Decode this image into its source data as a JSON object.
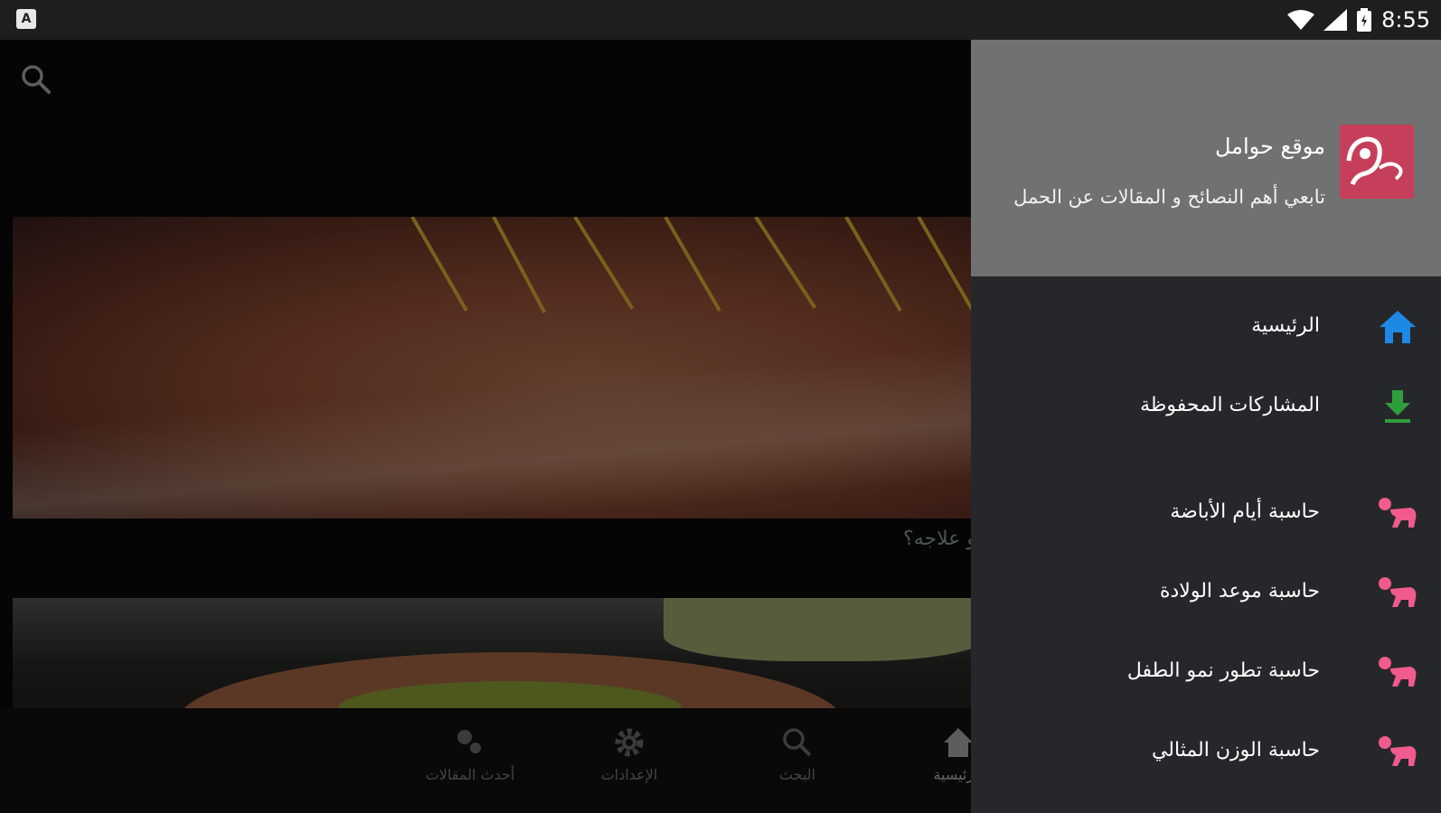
{
  "status_bar": {
    "left_icon_letter": "A",
    "time": "8:55",
    "icons": [
      "wifi-icon",
      "signal-icon",
      "battery-icon"
    ]
  },
  "main": {
    "search_icon": "search-icon",
    "card_caption": "و علاجه؟"
  },
  "bottom_nav": [
    {
      "label": "أحدث المقالات",
      "icon": "articles-icon"
    },
    {
      "label": "الإعدادات",
      "icon": "gear-icon"
    },
    {
      "label": "البحث",
      "icon": "search-icon"
    },
    {
      "label": "الرئيسية",
      "icon": "home-icon"
    }
  ],
  "drawer": {
    "app_name": "موقع حوامل",
    "tagline": "تابعي أهم النصائح و المقالات عن الحمل",
    "items": [
      {
        "label": "الرئيسية",
        "icon": "home-icon",
        "color": "#1e88e5"
      },
      {
        "label": "المشاركات المحفوظة",
        "icon": "download-icon",
        "color": "#2e9e3a"
      },
      {
        "label": "حاسبة أيام الأباضة",
        "icon": "baby-crawl-icon",
        "color": "#f05a8c"
      },
      {
        "label": "حاسبة موعد الولادة",
        "icon": "baby-crawl-icon",
        "color": "#f05a8c"
      },
      {
        "label": "حاسبة تطور نمو الطفل",
        "icon": "baby-crawl-icon",
        "color": "#f05a8c"
      },
      {
        "label": "حاسبة الوزن المثالي",
        "icon": "baby-crawl-icon",
        "color": "#f05a8c"
      }
    ]
  }
}
